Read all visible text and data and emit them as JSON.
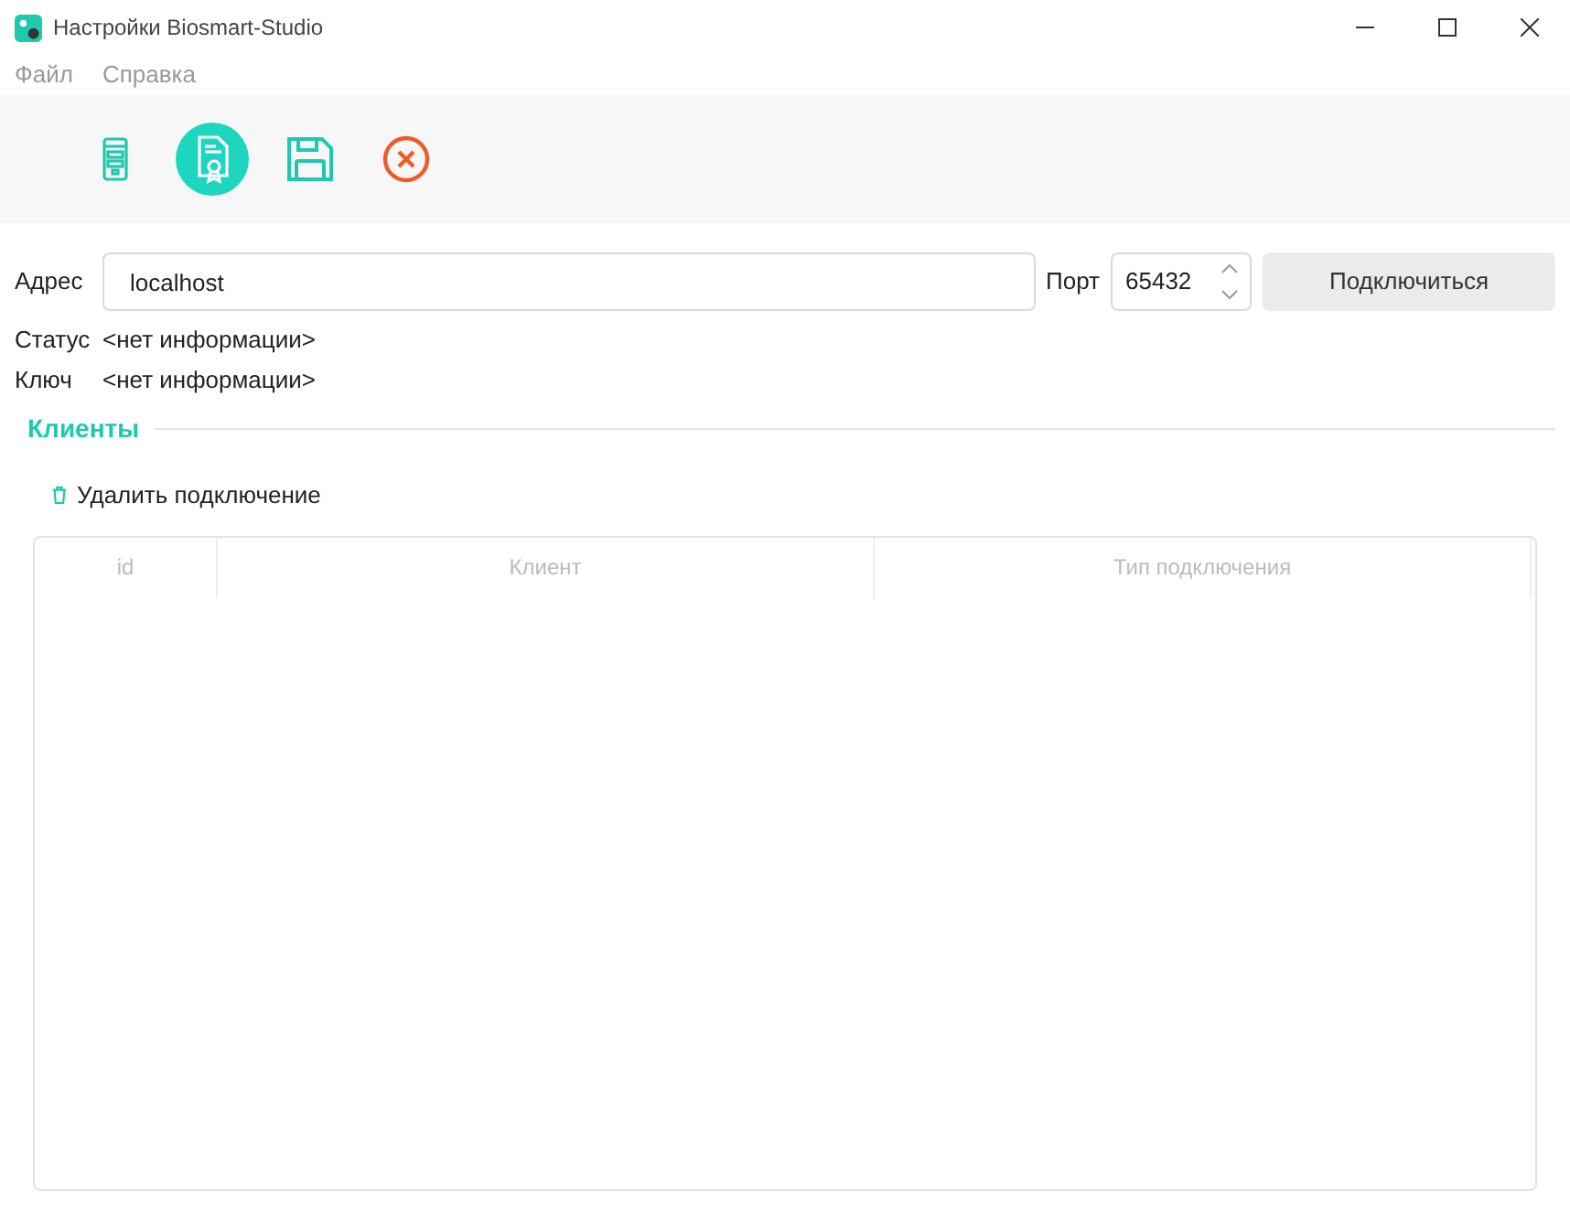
{
  "window": {
    "title": "Настройки Biosmart-Studio"
  },
  "menu": [
    "Файл",
    "Справка"
  ],
  "toolbar": [
    {
      "kind": "server",
      "selected": false
    },
    {
      "kind": "certificate",
      "selected": true
    },
    {
      "kind": "save",
      "selected": false
    },
    {
      "kind": "cancel",
      "selected": false
    }
  ],
  "address": {
    "label": "Адрес",
    "value": "localhost"
  },
  "port": {
    "label": "Порт",
    "value": "65432"
  },
  "connect_button": "Подключиться",
  "info": [
    {
      "label": "Статус",
      "value": "<нет информации>"
    },
    {
      "label": "Ключ",
      "value": "<нет информации>"
    }
  ],
  "clients": {
    "title": "Клиенты",
    "delete_button": "Удалить подключение",
    "table": {
      "columns": [
        "id",
        "Клиент",
        "Тип подключения"
      ]
    }
  }
}
